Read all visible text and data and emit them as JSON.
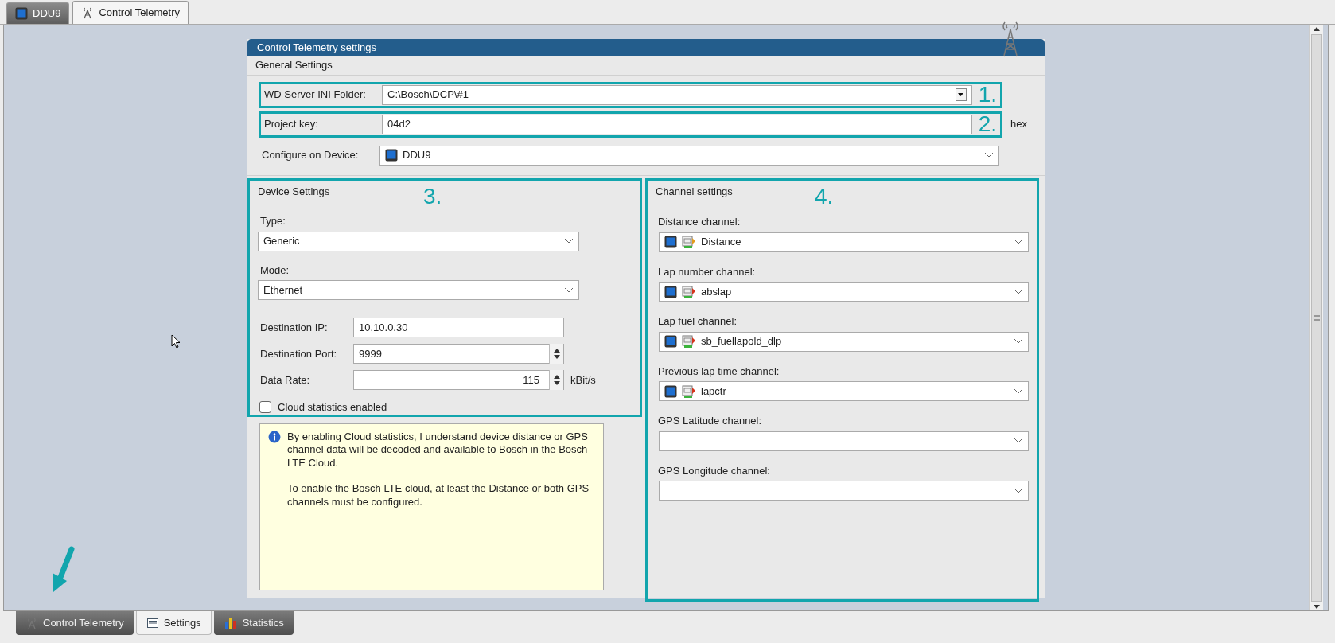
{
  "top_tabs": [
    {
      "label": "DDU9",
      "selected": false
    },
    {
      "label": "Control Telemetry",
      "selected": true
    }
  ],
  "dialog": {
    "title": "Control Telemetry settings",
    "general": {
      "title": "General Settings",
      "rows": [
        {
          "kind": "combo",
          "label": "WD Server INI Folder:",
          "value": "C:\\Bosch\\DCP\\#1",
          "marker": "1."
        },
        {
          "kind": "text",
          "label": "Project key:",
          "value": "04d2",
          "unit": "hex",
          "marker": "2."
        },
        {
          "kind": "select",
          "label": "Configure on Device:",
          "value": "DDU9"
        }
      ]
    },
    "device_settings": {
      "title": "Device Settings",
      "marker": "3.",
      "fields": [
        {
          "kind": "select",
          "label": "Type:",
          "value": "Generic"
        },
        {
          "kind": "select",
          "label": "Mode:",
          "value": "Ethernet"
        },
        {
          "kind": "text",
          "label": "Destination IP:",
          "value": "10.10.0.30"
        },
        {
          "kind": "spin",
          "label": "Destination Port:",
          "value": "9999"
        },
        {
          "kind": "rate",
          "label": "Data Rate:",
          "value": "115",
          "unit": "kBit/s"
        },
        {
          "kind": "checkbox",
          "label": "Cloud statistics enabled",
          "checked": false
        }
      ]
    },
    "info": {
      "paragraphs": [
        "By enabling Cloud statistics, I understand device distance or GPS channel data will be decoded and available to Bosch in the Bosch LTE Cloud.",
        "To enable the Bosch LTE cloud, at least the Distance or both GPS channels must be configured."
      ]
    },
    "channel_settings": {
      "title": "Channel settings",
      "marker": "4.",
      "channels": [
        {
          "label": "Distance channel:",
          "value": "Distance",
          "kind": "input"
        },
        {
          "label": "Lap number channel:",
          "value": "abslap",
          "kind": "calculated"
        },
        {
          "label": "Lap fuel channel:",
          "value": "sb_fuellapold_dlp",
          "kind": "calculated"
        },
        {
          "label": "Previous lap time channel:",
          "value": "lapctr",
          "kind": "calculated"
        },
        {
          "label": "GPS Latitude channel:"
        },
        {
          "label": "GPS Longitude channel:"
        }
      ]
    }
  },
  "bottom_tabs": [
    {
      "label": "Control Telemetry",
      "selected": false,
      "pointer": true
    },
    {
      "label": "Settings",
      "selected": true,
      "pointer": false
    },
    {
      "label": "Statistics",
      "selected": false,
      "pointer": false
    }
  ]
}
